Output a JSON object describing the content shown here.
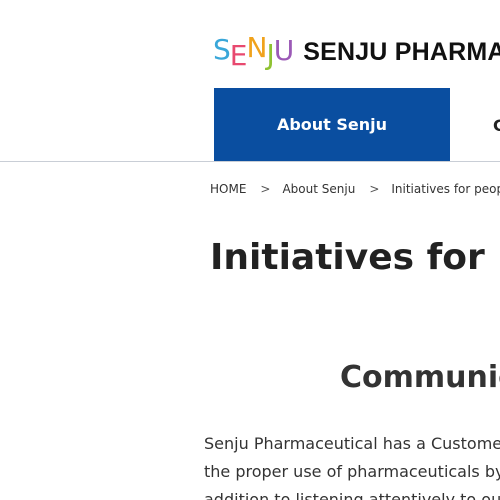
{
  "header": {
    "logo": {
      "mark_letters": [
        "S",
        "E",
        "N",
        "J",
        "U"
      ],
      "mark_colors": [
        "#3aa7d9",
        "#e8496f",
        "#f0a21c",
        "#8fc232",
        "#9b59b6"
      ],
      "text": "SENJU PHARMACE"
    },
    "nav": {
      "active_label": "About Senju",
      "next_label": "C",
      "active_color": "#0a4ea0"
    }
  },
  "breadcrumb": {
    "items": [
      "HOME",
      "About Senju",
      "Initiatives for people ar"
    ],
    "separator": ">"
  },
  "main": {
    "title": "Initiatives for pe",
    "section_heading": "Communica",
    "body_lines": [
      "Senju Pharmaceutical has a Customer S",
      "the proper use of pharmaceuticals by p",
      "addition to listening attentively to our c"
    ]
  }
}
